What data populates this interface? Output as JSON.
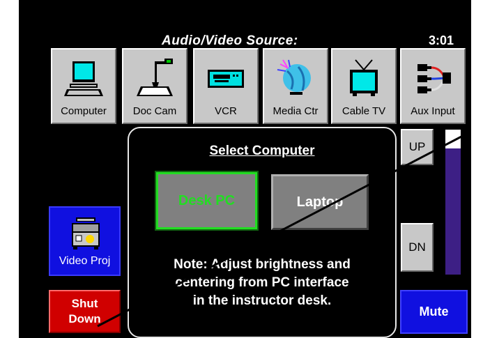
{
  "header": {
    "title": "Audio/Video Source:",
    "time": "3:01"
  },
  "sources": [
    {
      "label": "Computer",
      "icon": "computer-icon"
    },
    {
      "label": "Doc Cam",
      "icon": "document-camera-icon"
    },
    {
      "label": "VCR",
      "icon": "vcr-icon"
    },
    {
      "label": "Media Ctr",
      "icon": "media-center-icon"
    },
    {
      "label": "Cable TV",
      "icon": "television-icon"
    },
    {
      "label": "Aux Input",
      "icon": "aux-input-icon"
    }
  ],
  "volume": {
    "up_label": "UP",
    "down_label": "DN",
    "level": 0.87,
    "fill_color": "#3d1f85",
    "mute_label": "Mute"
  },
  "projector": {
    "label": "Video Proj",
    "icon": "projector-icon"
  },
  "shutdown": {
    "line1": "Shut",
    "line2": "Down"
  },
  "dialog": {
    "title": "Select Computer",
    "desk_label": "Desk PC",
    "laptop_label": "Laptop",
    "note_line1": "Note: Adjust brightness and",
    "note_line2": "centering from PC interface",
    "note_line3": "in the instructor desk."
  },
  "colors": {
    "background": "#000000",
    "button_gray": "#c8c8c8",
    "blue_button": "#1010e0",
    "red_button": "#d00000",
    "selected_green": "#22dd22"
  }
}
